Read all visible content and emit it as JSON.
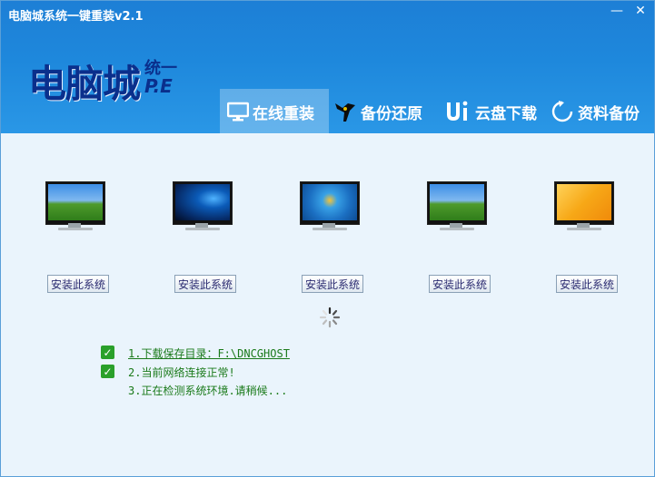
{
  "window": {
    "title": "电脑城系统一键重装v2.1",
    "minimize_glyph": "—",
    "close_glyph": "✕"
  },
  "logo": {
    "main": "电脑城",
    "small": "统一",
    "pe": "P.E"
  },
  "tabs": [
    {
      "label": "在线重装",
      "icon": "monitor-icon",
      "active": true
    },
    {
      "label": "备份还原",
      "icon": "mascot-icon",
      "active": false
    },
    {
      "label": "云盘下载",
      "icon": "ui-logo-icon",
      "active": false
    },
    {
      "label": "资料备份",
      "icon": "refresh-icon",
      "active": false
    }
  ],
  "systems": [
    {
      "wallpaper": "xp-bliss",
      "button": "安装此系统"
    },
    {
      "wallpaper": "win10",
      "button": "安装此系统"
    },
    {
      "wallpaper": "win7",
      "button": "安装此系统"
    },
    {
      "wallpaper": "xp-bliss",
      "button": "安装此系统"
    },
    {
      "wallpaper": "win8",
      "button": "安装此系统"
    }
  ],
  "status": [
    {
      "checked": true,
      "text": "1.下载保存目录：F:\\DNCGHOST",
      "link": true
    },
    {
      "checked": true,
      "text": "2.当前网络连接正常!",
      "link": false
    },
    {
      "checked": false,
      "text": "3.正在检测系统环境.请稍候...",
      "link": false
    }
  ],
  "colors": {
    "header": "#1e88dc",
    "logo": "#0a2f8c",
    "check": "#2aa02a",
    "link": "#1a7a1a"
  }
}
